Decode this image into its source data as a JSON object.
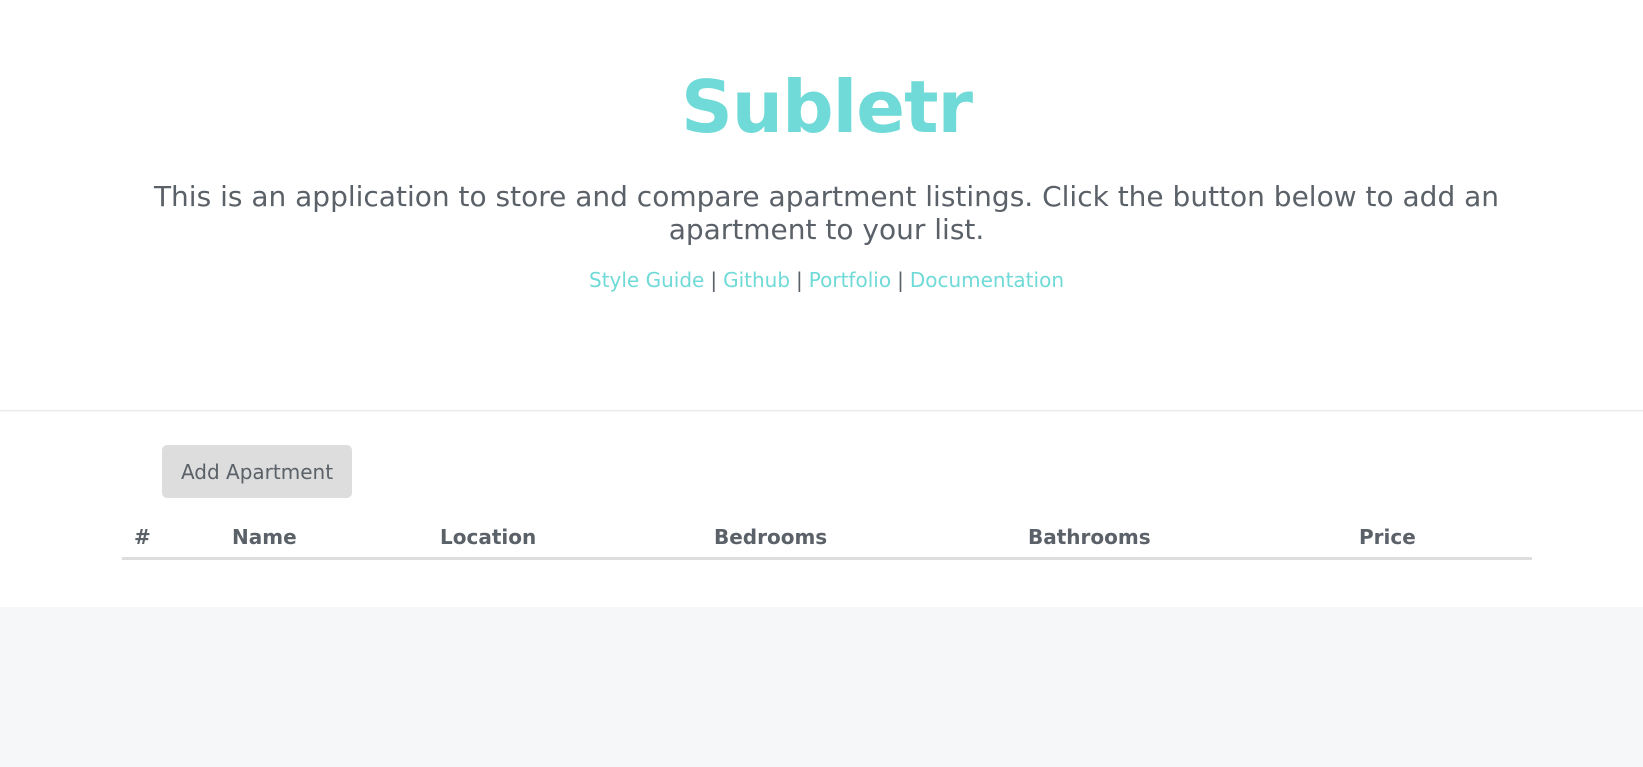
{
  "header": {
    "title": "Subletr",
    "description": "This is an application to store and compare apartment listings. Click the button below to add an apartment to your list.",
    "links": [
      "Style Guide",
      "Github",
      "Portfolio",
      "Documentation"
    ],
    "separator": "|"
  },
  "main": {
    "add_button_label": "Add Apartment",
    "table": {
      "columns": [
        "#",
        "Name",
        "Location",
        "Bedrooms",
        "Bathrooms",
        "Price"
      ],
      "rows": []
    }
  },
  "colors": {
    "accent": "#6fdad7",
    "text": "#5b6168",
    "page_background": "#f5f7f9",
    "button_background": "#dddddd"
  }
}
